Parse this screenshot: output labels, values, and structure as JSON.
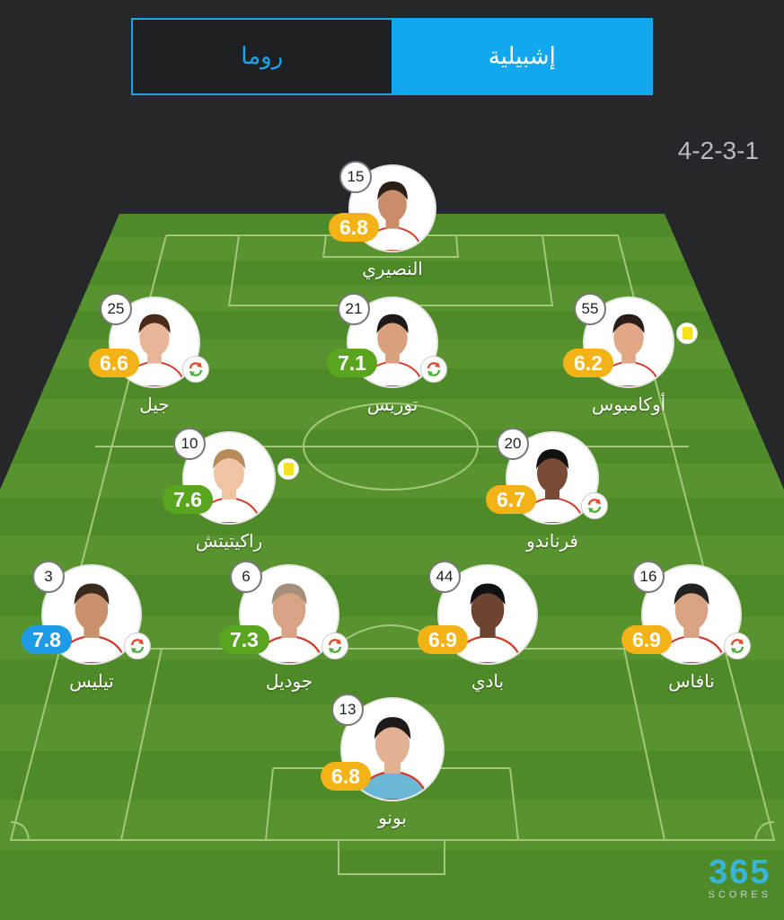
{
  "tabs": {
    "away": "روما",
    "home": "إشبيلية",
    "active": "home"
  },
  "formation": "4-2-3-1",
  "colors": {
    "accent": "#12a8f0",
    "rating_yellow": "#f3b316",
    "rating_green": "#5aa51f",
    "rating_blue": "#1e9be6"
  },
  "players": [
    {
      "number": "15",
      "name": "النصيري",
      "rating": "6.8",
      "rating_color": "yellow",
      "substituted": false,
      "yellow_card": false
    },
    {
      "number": "25",
      "name": "جيل",
      "rating": "6.6",
      "rating_color": "yellow",
      "substituted": true,
      "yellow_card": false
    },
    {
      "number": "21",
      "name": "توريس",
      "rating": "7.1",
      "rating_color": "green",
      "substituted": true,
      "yellow_card": false
    },
    {
      "number": "55",
      "name": "أوكامبوس",
      "rating": "6.2",
      "rating_color": "yellow",
      "substituted": false,
      "yellow_card": true
    },
    {
      "number": "10",
      "name": "راكيتيتش",
      "rating": "7.6",
      "rating_color": "green",
      "substituted": false,
      "yellow_card": true
    },
    {
      "number": "20",
      "name": "فرناندو",
      "rating": "6.7",
      "rating_color": "yellow",
      "substituted": true,
      "yellow_card": false
    },
    {
      "number": "3",
      "name": "تيليس",
      "rating": "7.8",
      "rating_color": "blue",
      "substituted": true,
      "yellow_card": false
    },
    {
      "number": "6",
      "name": "جوديل",
      "rating": "7.3",
      "rating_color": "green",
      "substituted": true,
      "yellow_card": false
    },
    {
      "number": "44",
      "name": "بادي",
      "rating": "6.9",
      "rating_color": "yellow",
      "substituted": false,
      "yellow_card": false
    },
    {
      "number": "16",
      "name": "نافاس",
      "rating": "6.9",
      "rating_color": "yellow",
      "substituted": true,
      "yellow_card": false
    },
    {
      "number": "13",
      "name": "بونو",
      "rating": "6.8",
      "rating_color": "yellow",
      "substituted": false,
      "yellow_card": false
    }
  ],
  "logo": {
    "main": "365",
    "sub": "SCORES"
  }
}
